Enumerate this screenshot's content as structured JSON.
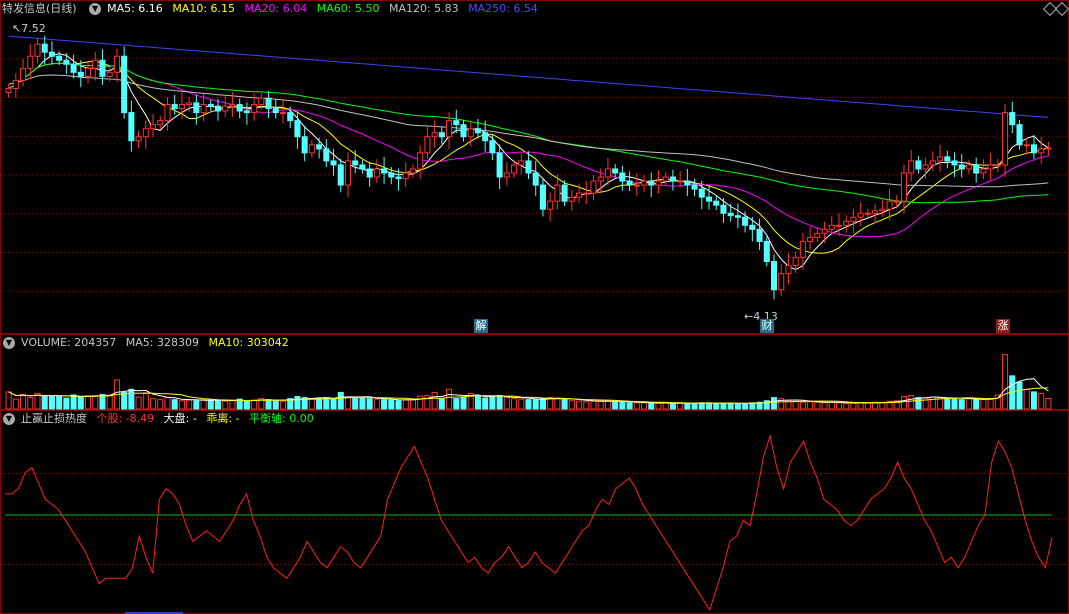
{
  "price_header": {
    "title": "特发信息(日线)",
    "ma5": "MA5: 6.16",
    "ma10": "MA10: 6.15",
    "ma20": "MA20: 6.04",
    "ma60": "MA60: 5.50",
    "ma120": "MA120: 5.83",
    "ma250": "MA250: 6.54"
  },
  "price_annotations": {
    "high": "7.52",
    "low": "4.13"
  },
  "event_tags": {
    "jie": "解",
    "cai": "财",
    "zhang": "涨"
  },
  "volume_header": {
    "volume": "VOLUME: 204357",
    "ma5": "MA5: 328309",
    "ma10": "MA10: 303042"
  },
  "indicator_header": {
    "name": "止赢止损热度",
    "stock": "个股: -8.49",
    "market": "大盘: -",
    "deviation": "乖离: -",
    "balance": "平衡轴: 0.00"
  },
  "icons": {
    "collapse": "chevron-down-icon",
    "settings_1": "diamond-icon",
    "settings_2": "diamond-icon"
  },
  "colors": {
    "up": "#ff3232",
    "down": "#54ffff",
    "ma5": "#ffffff",
    "ma10": "#ffff00",
    "ma20": "#ff00ff",
    "ma60": "#00ff00",
    "ma120": "#c0c0c0",
    "ma250": "#4040ff",
    "grid": "#8b0000",
    "heat": "#ff2020",
    "balance": "#00c000"
  },
  "chart_data": [
    {
      "type": "candlestick",
      "title": "特发信息(日线)",
      "ylim": [
        3.9,
        7.75
      ],
      "annotations": [
        {
          "label": "7.52",
          "value": 7.52
        },
        {
          "label": "4.13",
          "value": 4.13
        }
      ],
      "close": [
        6.9,
        7.0,
        7.15,
        7.3,
        7.45,
        7.35,
        7.3,
        7.25,
        7.2,
        7.1,
        7.05,
        7.15,
        7.25,
        7.05,
        7.1,
        7.3,
        6.6,
        6.25,
        6.3,
        6.4,
        6.45,
        6.5,
        6.7,
        6.65,
        6.7,
        6.72,
        6.6,
        6.7,
        6.68,
        6.62,
        6.68,
        6.7,
        6.62,
        6.6,
        6.7,
        6.78,
        6.65,
        6.6,
        6.6,
        6.5,
        6.3,
        6.1,
        6.2,
        6.15,
        6.0,
        5.95,
        5.7,
        6.0,
        5.95,
        5.9,
        5.8,
        5.9,
        5.85,
        5.8,
        5.78,
        5.85,
        5.9,
        6.1,
        6.3,
        6.35,
        6.3,
        6.5,
        6.45,
        6.3,
        6.4,
        6.35,
        6.25,
        6.1,
        5.8,
        5.85,
        5.95,
        6.0,
        5.85,
        5.7,
        5.4,
        5.5,
        5.7,
        5.5,
        5.55,
        5.6,
        5.6,
        5.75,
        5.8,
        5.9,
        5.85,
        5.75,
        5.7,
        5.7,
        5.75,
        5.7,
        5.75,
        5.8,
        5.75,
        5.75,
        5.7,
        5.65,
        5.55,
        5.5,
        5.45,
        5.35,
        5.32,
        5.3,
        5.2,
        5.15,
        5.0,
        4.75,
        4.4,
        4.6,
        4.7,
        4.8,
        5.0,
        5.05,
        5.1,
        5.15,
        5.2,
        5.2,
        5.25,
        5.3,
        5.35,
        5.35,
        5.38,
        5.4,
        5.5,
        5.5,
        5.85,
        6.0,
        5.9,
        5.95,
        6.0,
        6.05,
        6.0,
        5.95,
        5.9,
        5.95,
        5.85,
        5.9,
        5.95,
        5.95,
        6.6,
        6.45,
        6.2,
        6.2,
        6.1,
        6.15,
        6.16
      ],
      "series": [
        {
          "name": "MA5",
          "values": [
            6.16
          ]
        },
        {
          "name": "MA10",
          "values": [
            6.15
          ]
        },
        {
          "name": "MA20",
          "values": [
            6.04
          ]
        },
        {
          "name": "MA60",
          "values": [
            5.5
          ]
        },
        {
          "name": "MA120",
          "values": [
            5.83
          ]
        },
        {
          "name": "MA250",
          "values": [
            6.54
          ]
        }
      ]
    },
    {
      "type": "bar",
      "title": "VOLUME",
      "ylim": [
        0,
        1100000
      ],
      "values": [
        330000,
        190000,
        280000,
        220000,
        300000,
        260000,
        240000,
        250000,
        210000,
        270000,
        230000,
        250000,
        260000,
        280000,
        270000,
        560000,
        320000,
        380000,
        230000,
        300000,
        200000,
        180000,
        220000,
        180000,
        160000,
        170000,
        160000,
        180000,
        170000,
        160000,
        150000,
        160000,
        190000,
        150000,
        170000,
        200000,
        180000,
        160000,
        150000,
        200000,
        240000,
        220000,
        200000,
        210000,
        220000,
        190000,
        320000,
        230000,
        210000,
        220000,
        200000,
        190000,
        180000,
        170000,
        160000,
        180000,
        190000,
        250000,
        260000,
        320000,
        190000,
        380000,
        200000,
        220000,
        300000,
        260000,
        210000,
        230000,
        260000,
        220000,
        200000,
        190000,
        180000,
        180000,
        200000,
        220000,
        210000,
        180000,
        160000,
        150000,
        140000,
        150000,
        150000,
        160000,
        140000,
        130000,
        120000,
        120000,
        120000,
        110000,
        110000,
        120000,
        110000,
        110000,
        110000,
        110000,
        120000,
        120000,
        110000,
        110000,
        110000,
        100000,
        110000,
        120000,
        130000,
        160000,
        220000,
        200000,
        150000,
        140000,
        130000,
        140000,
        130000,
        120000,
        130000,
        120000,
        110000,
        110000,
        120000,
        120000,
        130000,
        130000,
        150000,
        160000,
        240000,
        260000,
        220000,
        210000,
        230000,
        220000,
        210000,
        190000,
        180000,
        200000,
        190000,
        180000,
        200000,
        270000,
        1050000,
        640000,
        520000,
        380000,
        330000,
        300000,
        204357
      ],
      "series": [
        {
          "name": "MA5",
          "values": [
            328309
          ]
        },
        {
          "name": "MA10",
          "values": [
            303042
          ]
        }
      ]
    },
    {
      "type": "line",
      "title": "止赢止损热度",
      "ylim": [
        -36,
        33
      ],
      "series": [
        {
          "name": "个股",
          "values": [
            8,
            8,
            10,
            16,
            18,
            12,
            6,
            4,
            2,
            -2,
            -6,
            -10,
            -14,
            -20,
            -26,
            -24,
            -24,
            -24,
            -24,
            -20,
            -8,
            -16,
            -22,
            6,
            10,
            8,
            4,
            -4,
            -10,
            -8,
            -6,
            -8,
            -10,
            -6,
            -2,
            4,
            8,
            -2,
            -8,
            -16,
            -20,
            -22,
            -24,
            -20,
            -16,
            -10,
            -14,
            -18,
            -20,
            -16,
            -12,
            -14,
            -18,
            -20,
            -16,
            -12,
            -8,
            6,
            12,
            18,
            22,
            26,
            20,
            14,
            6,
            -2,
            -6,
            -10,
            -14,
            -18,
            -16,
            -20,
            -22,
            -18,
            -16,
            -12,
            -16,
            -20,
            -18,
            -14,
            -18,
            -20,
            -22,
            -18,
            -14,
            -10,
            -6,
            -4,
            2,
            6,
            4,
            10,
            12,
            14,
            10,
            4,
            0,
            -4,
            -8,
            -12,
            -16,
            -20,
            -24,
            -28,
            -32,
            -36,
            -28,
            -20,
            -10,
            -8,
            -2,
            -4,
            8,
            22,
            30,
            18,
            10,
            20,
            24,
            28,
            20,
            14,
            6,
            4,
            2,
            -2,
            -4,
            -2,
            2,
            6,
            8,
            10,
            14,
            20,
            14,
            10,
            4,
            -2,
            -6,
            -12,
            -18,
            -16,
            -20,
            -16,
            -10,
            -4,
            0,
            20,
            28,
            24,
            18,
            8,
            -2,
            -10,
            -16,
            -20,
            -8.49
          ]
        },
        {
          "name": "平衡轴",
          "values": [
            0
          ]
        }
      ]
    }
  ]
}
